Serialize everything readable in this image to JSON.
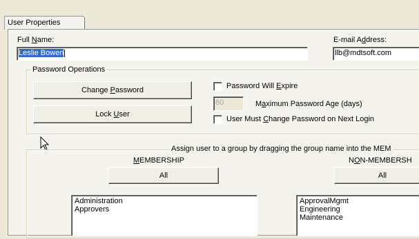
{
  "tab": {
    "label": "User Properties"
  },
  "form": {
    "full_name": {
      "label_pre": "Full ",
      "label_u": "N",
      "label_post": "ame:",
      "value": "Leslie Bowen"
    },
    "email": {
      "label_pre": "E-mail A",
      "label_u": "d",
      "label_post": "dress:",
      "value": "llb@mdtsoft.com"
    }
  },
  "password_ops": {
    "title": "Password Operations",
    "change_pre": "Change ",
    "change_u": "P",
    "change_post": "assword",
    "lock_pre": "Lock ",
    "lock_u": "U",
    "lock_post": "ser",
    "will_expire_pre": "Password Will ",
    "will_expire_u": "E",
    "will_expire_post": "xpire",
    "max_age_value": "60",
    "max_age_pre": "M",
    "max_age_u": "a",
    "max_age_post": "ximum Password Age (days)",
    "must_change_pre": "User Must ",
    "must_change_u": "C",
    "must_change_post": "hange Password on Next Login"
  },
  "groups": {
    "instruction": "Assign user to a group by dragging the group name into the MEM",
    "membership": {
      "title_u": "M",
      "title_post": "EMBERSHIP",
      "all_label": "All",
      "items": [
        "Administration",
        "Approvers"
      ]
    },
    "non_membership": {
      "title_pre": "N",
      "title_u": "O",
      "title_post": "N-MEMBERSH",
      "all_label": "All",
      "items": [
        "ApprovalMgmt",
        "Engineering",
        "Maintenance"
      ]
    }
  }
}
